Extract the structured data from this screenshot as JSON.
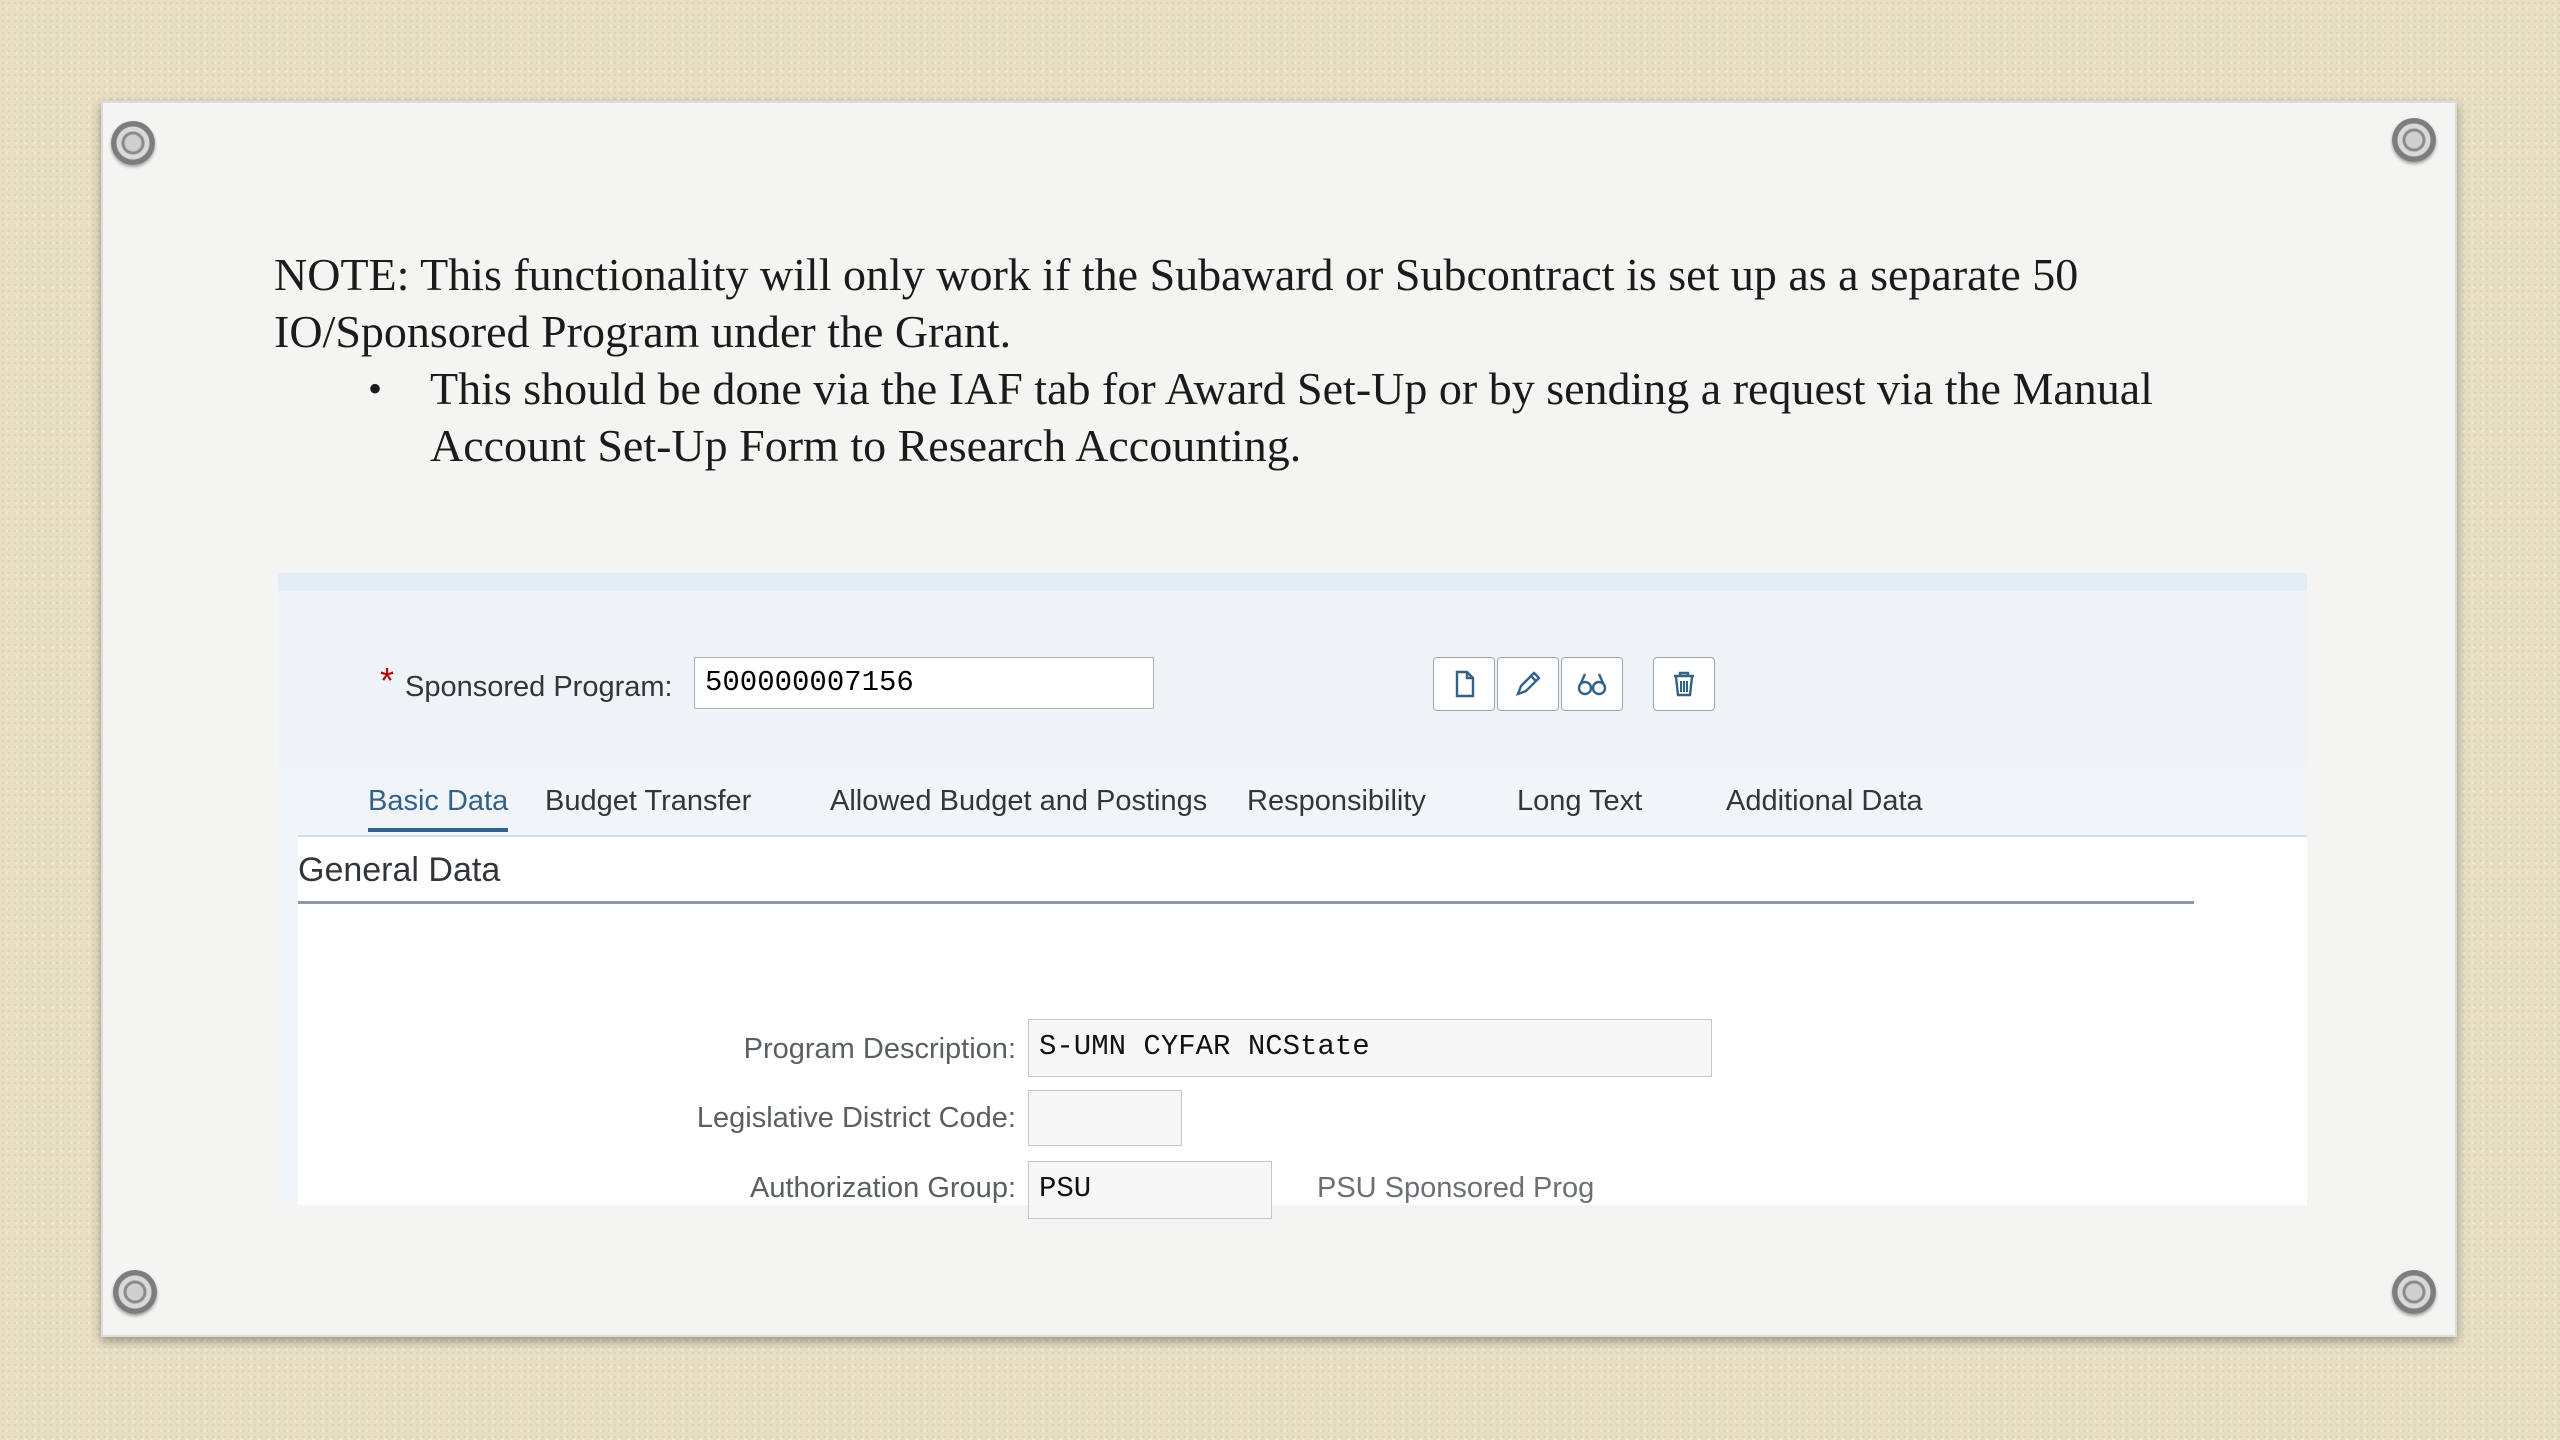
{
  "note": {
    "line1": "NOTE:  This functionality will only work if  the Subaward or Subcontract is set up as a separate 50 IO/Sponsored Program under the Grant.",
    "bullet_symbol": "•",
    "bullet": "This should be done via the IAF tab for Award Set-Up or by sending a request via the Manual Account Set-Up Form to Research Accounting."
  },
  "header": {
    "required_marker": "*",
    "sponsored_program_label": "Sponsored Program:",
    "sponsored_program_value": "500000007156",
    "toolbar_icons": [
      "create-icon",
      "edit-icon",
      "display-icon",
      "delete-icon"
    ]
  },
  "tabs": [
    {
      "label": "Basic Data",
      "active": true
    },
    {
      "label": "Budget Transfer",
      "active": false
    },
    {
      "label": "Allowed Budget and Postings",
      "active": false
    },
    {
      "label": "Responsibility",
      "active": false
    },
    {
      "label": "Long Text",
      "active": false
    },
    {
      "label": "Additional Data",
      "active": false
    }
  ],
  "section": {
    "title": "General Data",
    "fields": {
      "program_description_label": "Program Description:",
      "program_description_value": "S-UMN CYFAR NCState",
      "legislative_district_label": "Legislative District Code:",
      "legislative_district_value": "",
      "authorization_group_label": "Authorization Group:",
      "authorization_group_value": "PSU",
      "authorization_group_text": "PSU Sponsored Prog"
    }
  },
  "colors": {
    "accent": "#346187",
    "required": "#bb0000"
  }
}
